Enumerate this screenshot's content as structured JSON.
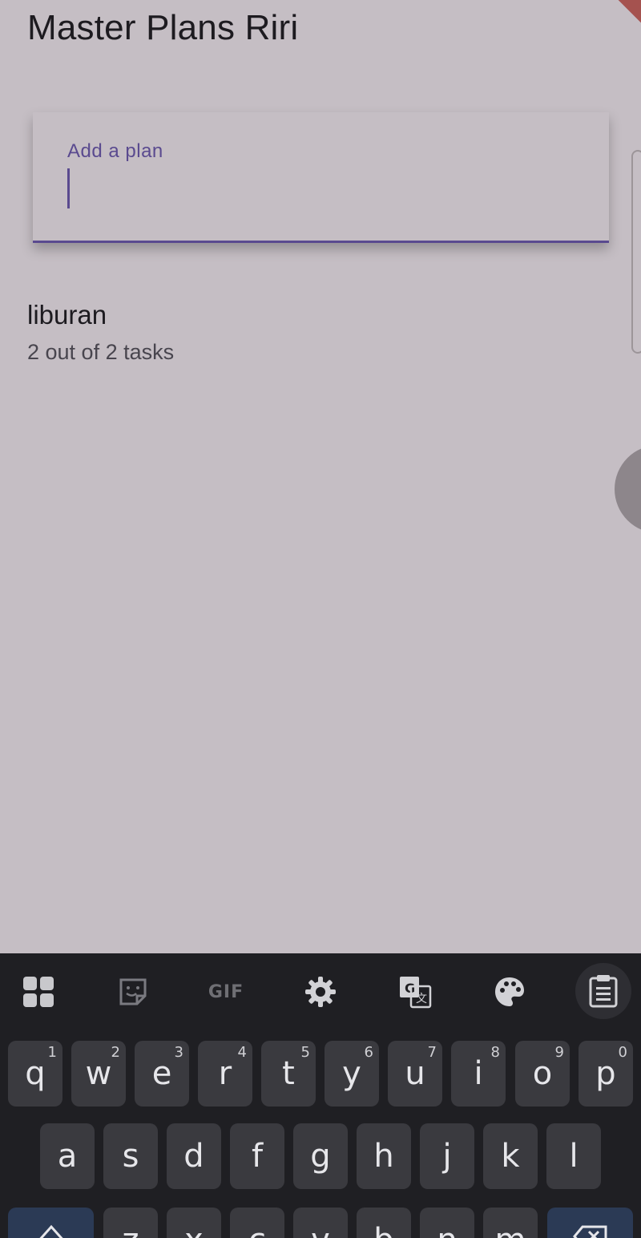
{
  "app": {
    "title": "Master Plans Riri"
  },
  "input": {
    "label": "Add a plan",
    "value": ""
  },
  "plans": [
    {
      "name": "liburan",
      "progress_text": "2 out of 2 tasks"
    }
  ],
  "keyboard": {
    "toolbar": {
      "apps": "apps-grid-icon",
      "sticker": "sticker-icon",
      "gif_label": "GIF",
      "settings": "gear-icon",
      "translate": "translate-icon",
      "theme": "palette-icon",
      "clipboard": "clipboard-icon"
    },
    "row1": [
      {
        "key": "q",
        "num": "1"
      },
      {
        "key": "w",
        "num": "2"
      },
      {
        "key": "e",
        "num": "3"
      },
      {
        "key": "r",
        "num": "4"
      },
      {
        "key": "t",
        "num": "5"
      },
      {
        "key": "y",
        "num": "6"
      },
      {
        "key": "u",
        "num": "7"
      },
      {
        "key": "i",
        "num": "8"
      },
      {
        "key": "o",
        "num": "9"
      },
      {
        "key": "p",
        "num": "0"
      }
    ],
    "row2": [
      "a",
      "s",
      "d",
      "f",
      "g",
      "h",
      "j",
      "k",
      "l"
    ],
    "row3": [
      "z",
      "x",
      "c",
      "v",
      "b",
      "n",
      "m"
    ]
  },
  "colors": {
    "background": "#c5bec4",
    "accent": "#5a4a8f",
    "keyboard_bg": "#1f1f23",
    "key_bg": "#3a3a3f"
  }
}
